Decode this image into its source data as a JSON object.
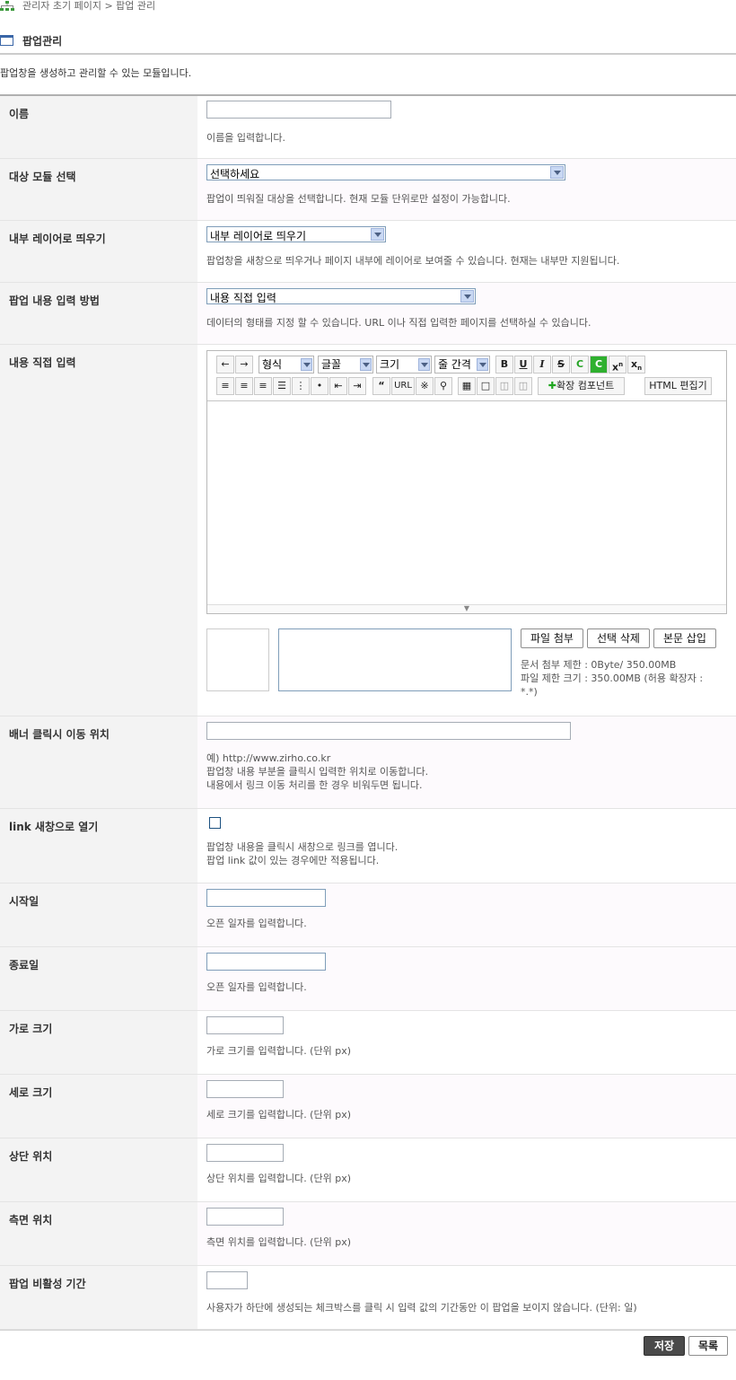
{
  "breadcrumb": "관리자 초기 페이지 > 팝업 관리",
  "page_title": "팝업관리",
  "page_desc": "팝업창을 생성하고 관리할 수 있는 모듈입니다.",
  "fields": {
    "name": {
      "label": "이름",
      "help": "이름을 입력합니다."
    },
    "target": {
      "label": "대상 모듈 선택",
      "value": "선택하세요",
      "help": "팝업이 띄워질 대상을 선택합니다. 현재 모듈 단위로만 설정이 가능합니다."
    },
    "layer": {
      "label": "내부 레이어로 띄우기",
      "value": "내부 레이어로 띄우기",
      "help": "팝업창을 새창으로 띄우거나 페이지 내부에 레이어로 보여줄 수 있습니다. 현재는 내부만 지원됩니다."
    },
    "input_method": {
      "label": "팝업 내용 입력 방법",
      "value": "내용 직접 입력",
      "help": "데이터의 형태를 지정 할 수 있습니다. URL 이나 직접 입력한 페이지를 선택하실 수 있습니다."
    },
    "content": {
      "label": "내용 직접 입력"
    },
    "banner": {
      "label": "배너 클릭시 이동 위치",
      "help1": "예) http://www.zirho.co.kr",
      "help2": "팝업창 내용 부분을 클릭시 입력한 위치로 이동합니다.",
      "help3": "내용에서 링크 이동 처리를 한 경우 비워두면 됩니다."
    },
    "link_new": {
      "label": "link 새창으로 열기",
      "help1": "팝업창 내용을 클릭시 새창으로 링크를 엽니다.",
      "help2": "팝업 link 값이 있는 경우에만 적용됩니다."
    },
    "start": {
      "label": "시작일",
      "help": "오픈 일자를 입력합니다."
    },
    "end": {
      "label": "종료일",
      "help": "오픈 일자를 입력합니다."
    },
    "width": {
      "label": "가로 크기",
      "help": "가로 크기를 입력합니다. (단위 px)"
    },
    "height": {
      "label": "세로 크기",
      "help": "세로 크기를 입력합니다. (단위 px)"
    },
    "top": {
      "label": "상단 위치",
      "help": "상단 위치를 입력합니다. (단위 px)"
    },
    "side": {
      "label": "측면 위치",
      "help": "측면 위치를 입력합니다. (단위 px)"
    },
    "inactive": {
      "label": "팝업 비활성 기간",
      "help": "사용자가 하단에 생성되는 체크박스를 클릭 시 입력 값의 기간동안 이 팝업을 보이지 않습니다. (단위: 일)"
    }
  },
  "editor": {
    "format": "형식",
    "font": "글꼴",
    "size": "크기",
    "line_height": "줄 간격",
    "url_btn": "URL",
    "ext_component": "확장 컴포넌트",
    "html_editor": "HTML 편집기",
    "bold": "B",
    "underline": "U",
    "italic": "I",
    "strike": "S",
    "color": "C",
    "bgcolor": "C"
  },
  "attachments": {
    "file_attach": "파일 첨부",
    "delete_selected": "선택 삭제",
    "insert_body": "본문 삽입",
    "limit_doc": "문서 첨부 제한 : 0Byte/ 350.00MB",
    "limit_file": "파일 제한 크기 : 350.00MB (허용 확장자 :",
    "limit_ext": "*.*)"
  },
  "actions": {
    "save": "저장",
    "list": "목록"
  },
  "colors": {
    "accent_blue": "#3a66a7",
    "label_bg": "#f3f3f3",
    "save_bg": "#4a4a4a"
  }
}
